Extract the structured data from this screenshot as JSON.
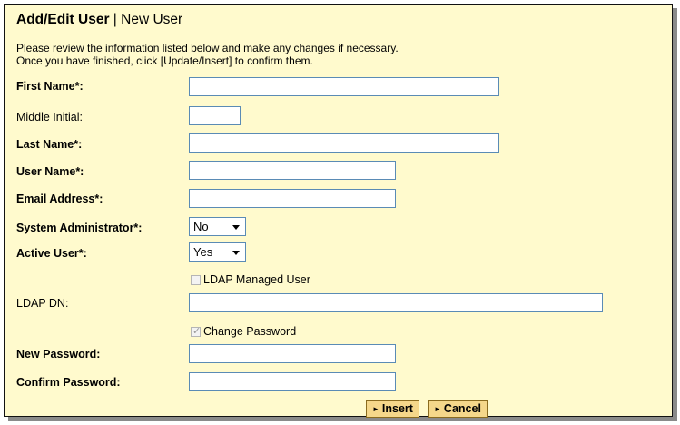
{
  "header": {
    "title_bold": "Add/Edit User",
    "separator": " | ",
    "title_sub": "New User"
  },
  "intro": {
    "line1": "Please review the information listed below and make any changes if necessary.",
    "line2": "Once you have finished, click [Update/Insert] to confirm them."
  },
  "fields": {
    "first_name": {
      "label": "First Name*:",
      "value": ""
    },
    "middle_initial": {
      "label": "Middle Initial:",
      "value": ""
    },
    "last_name": {
      "label": "Last Name*:",
      "value": ""
    },
    "user_name": {
      "label": "User Name*:",
      "value": ""
    },
    "email": {
      "label": "Email Address*:",
      "value": ""
    },
    "system_admin": {
      "label": "System Administrator*:",
      "value": "No"
    },
    "active_user": {
      "label": "Active User*:",
      "value": "Yes"
    },
    "ldap_managed": {
      "label": "LDAP Managed User",
      "checked": false,
      "disabled": true
    },
    "ldap_dn": {
      "label": "LDAP DN:",
      "value": ""
    },
    "change_password": {
      "label": "Change Password",
      "checked": true,
      "disabled": true
    },
    "new_password": {
      "label": "New Password:",
      "value": ""
    },
    "confirm_password": {
      "label": "Confirm Password:",
      "value": ""
    }
  },
  "buttons": {
    "insert_label": "Insert",
    "cancel_label": "Cancel",
    "arrow": "►"
  },
  "icons": {
    "dropdown": "chevron-down-icon",
    "checkbox_checked": "✓"
  },
  "colors": {
    "panel_bg": "#fffacd",
    "input_border": "#5a8bb5",
    "button_bg": "#f5d78a"
  }
}
